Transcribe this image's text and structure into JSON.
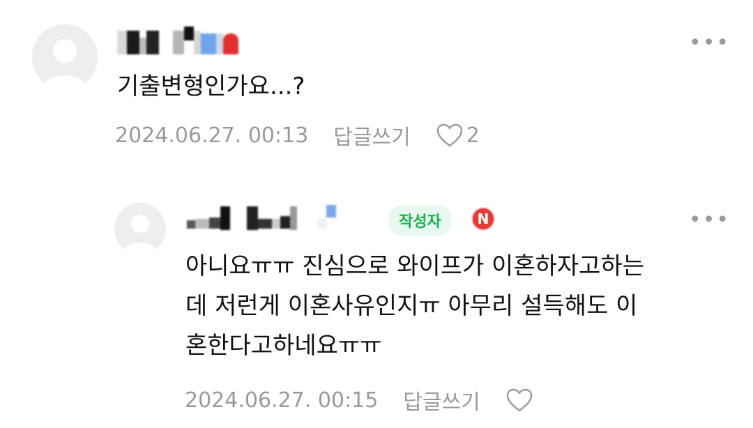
{
  "comments": [
    {
      "text": "기출변형인가요...?",
      "timestamp": "2024.06.27. 00:13",
      "reply_label": "답글쓰기",
      "like_count": "2",
      "more_label": "•••"
    },
    {
      "writer_badge": "작성자",
      "n_badge": "N",
      "text_lines": [
        "아니요ㅠㅠ 진심으로 와이프가 이혼하자고하는",
        "데 저런게 이혼사유인지ㅠ 아무리 설득해도 이",
        "혼한다고하네요ㅠㅠ"
      ],
      "timestamp": "2024.06.27. 00:15",
      "reply_label": "답글쓰기",
      "more_label": "•••"
    }
  ],
  "colors": {
    "meta": "#9a9a9a",
    "writer_badge_bg": "#e9f8ee",
    "writer_badge_text": "#19b34f",
    "n_badge": "#e43b3b"
  }
}
